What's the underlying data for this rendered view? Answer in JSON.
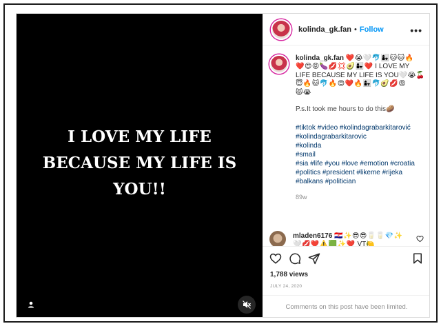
{
  "media": {
    "caption_lines": [
      "I LOVE MY LIFE",
      "BECAUSE MY LIFE IS",
      "YOU!!"
    ]
  },
  "header": {
    "username": "kolinda_gk.fan",
    "separator": "•",
    "follow_label": "Follow",
    "more_label": "•••"
  },
  "caption": {
    "username": "kolinda_gk.fan",
    "line1_emoji": "❤️😭🤍🐬👩‍👧🐱🐱🔥",
    "line2_emoji": "❤️😍😡🍆💋💢🥑👩‍👧❤️",
    "line2_text": "I LOVE MY",
    "line3_text": "LIFE BECAUSE MY LIFE IS YOU",
    "line3_emoji": "🤍😭🍒",
    "line4_emoji": "😇🔥🐱🐬🔥😍❤️🔥👩‍👧🐬🥑💋😡",
    "line5_emoji": "😾😭",
    "ps_note": "P.s.It took me hours to do this",
    "ps_emoji": "🥔",
    "hashtags": [
      "#tiktok #video #kolindagrabarkitarović",
      "#kolindagrabarkitarovic",
      "#kolinda",
      "#smail",
      "#sia #life #you #love #emotion #croatia",
      "#politics #president #likeme #rijeka",
      "#balkans #politician"
    ],
    "time_ago": "89w"
  },
  "comment": {
    "username": "mladen6176",
    "line1_emoji": "🇭🇷✨😎😎🥛🥛💎✨",
    "line2_emoji": "🤍💋❤️⚠️🟩✨❤️",
    "line2_text": "VT",
    "line2_tail": "🍋"
  },
  "stats": {
    "views": "1,788 views",
    "date": "JULY 24, 2020",
    "comments_limited": "Comments on this post have been limited."
  },
  "icons": {
    "like": "heart-icon",
    "comment": "comment-icon",
    "share": "paper-plane-icon",
    "save": "bookmark-icon",
    "user_tag": "person-icon",
    "mute": "muted-speaker-icon"
  }
}
